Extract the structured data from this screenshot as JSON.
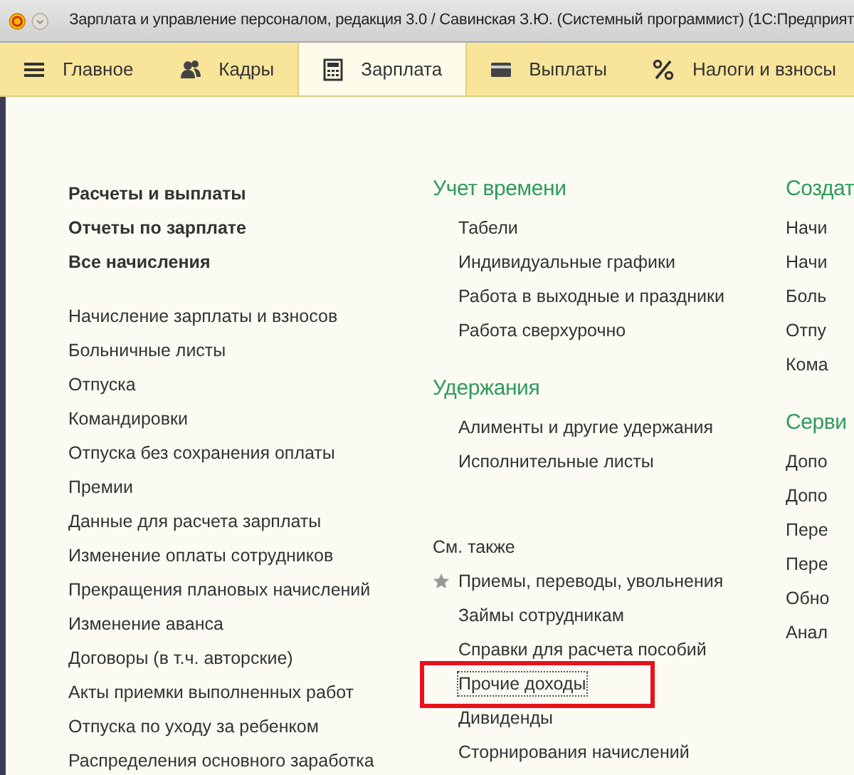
{
  "window": {
    "title": "Зарплата и управление персоналом, редакция 3.0 / Савинская З.Ю. (Системный программист)  (1С:Предприят"
  },
  "tabs": [
    {
      "label": "Главное",
      "kind": "menu",
      "selected": false
    },
    {
      "label": "Кадры",
      "kind": "people",
      "selected": false
    },
    {
      "label": "Зарплата",
      "kind": "calculator",
      "selected": true
    },
    {
      "label": "Выплаты",
      "kind": "card",
      "selected": false
    },
    {
      "label": "Налоги и взносы",
      "kind": "percent",
      "selected": false
    }
  ],
  "left_column": {
    "main_links": [
      "Расчеты и выплаты",
      "Отчеты по зарплате",
      "Все начисления"
    ],
    "documents": [
      "Начисление зарплаты и взносов",
      "Больничные листы",
      "Отпуска",
      "Командировки",
      "Отпуска без сохранения оплаты",
      "Премии",
      "Данные для расчета зарплаты",
      "Изменение оплаты сотрудников",
      "Прекращения плановых начислений",
      "Изменение аванса",
      "Договоры (в т.ч. авторские)",
      "Акты приемки выполненных работ",
      "Отпуска по уходу за ребенком",
      "Распределения основного заработка"
    ]
  },
  "middle_column": {
    "groups": [
      {
        "title": "Учет времени",
        "items": [
          "Табели",
          "Индивидуальные графики",
          "Работа в выходные и праздники",
          "Работа сверхурочно"
        ]
      },
      {
        "title": "Удержания",
        "items": [
          "Алименты и другие удержания",
          "Исполнительные листы"
        ]
      }
    ],
    "see_also": {
      "title": "См. также",
      "items": [
        {
          "label": "Приемы, переводы, увольнения",
          "starred": true,
          "focused": false
        },
        {
          "label": "Займы сотрудникам",
          "starred": false,
          "focused": false
        },
        {
          "label": "Справки для расчета пособий",
          "starred": false,
          "focused": false
        },
        {
          "label": "Прочие доходы",
          "starred": false,
          "focused": true
        },
        {
          "label": "Дивиденды",
          "starred": false,
          "focused": false
        },
        {
          "label": "Сторнирования начислений",
          "starred": false,
          "focused": false
        }
      ]
    }
  },
  "right_column": {
    "groups": [
      {
        "title": "Создат",
        "items": [
          "Начи",
          "Начи",
          "Боль",
          "Отпу",
          "Кома"
        ]
      },
      {
        "title": "Серви",
        "items": [
          "Допо",
          "Допо",
          "Пере",
          "Пере",
          "Обно",
          "Анал"
        ]
      }
    ]
  },
  "highlight": {
    "shown": true
  }
}
